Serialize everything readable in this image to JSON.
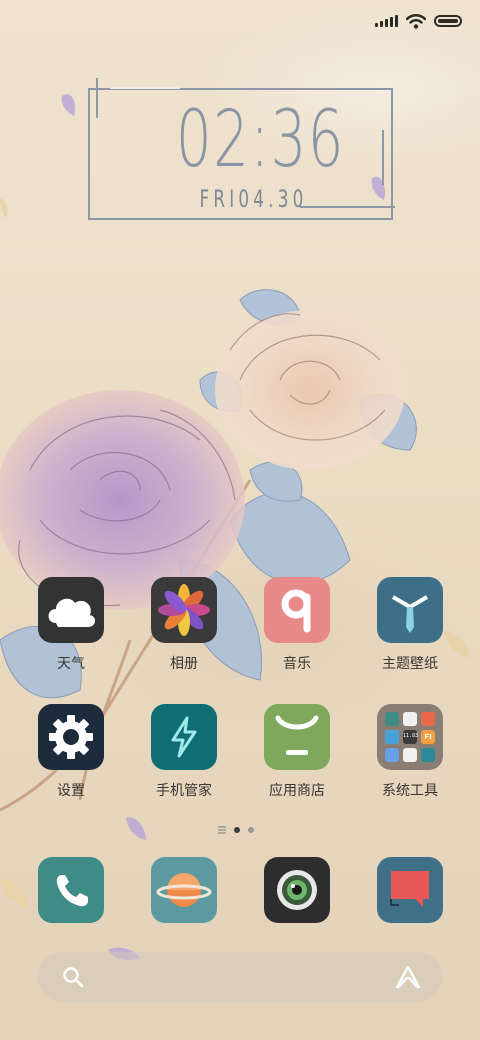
{
  "status_bar": {
    "signal": "signal-icon",
    "wifi": "wifi-icon",
    "battery": "battery-icon"
  },
  "clock": {
    "time": "02:36",
    "date": "FRI04.30"
  },
  "apps": [
    {
      "label": "天气",
      "icon": "weather-cloud-icon"
    },
    {
      "label": "相册",
      "icon": "gallery-flower-icon"
    },
    {
      "label": "音乐",
      "icon": "music-q-icon"
    },
    {
      "label": "主题壁纸",
      "icon": "themes-tie-icon"
    },
    {
      "label": "设置",
      "icon": "settings-gear-icon"
    },
    {
      "label": "手机管家",
      "icon": "security-bolt-icon"
    },
    {
      "label": "应用商店",
      "icon": "app-store-bag-icon"
    },
    {
      "label": "系统工具",
      "icon": "system-tools-folder-icon"
    }
  ],
  "folder_mini_labels": [
    "11.83",
    "FI"
  ],
  "pager": {
    "pages": 2,
    "active": 1
  },
  "dock": [
    {
      "icon": "phone-icon"
    },
    {
      "icon": "browser-planet-icon"
    },
    {
      "icon": "camera-icon"
    },
    {
      "icon": "messages-icon"
    }
  ],
  "search": {
    "icon": "search-icon",
    "assistant_icon": "assistant-a-icon"
  },
  "colors": {
    "weather": "#333333",
    "gallery": "#3a3a3a",
    "music": "#e88a8a",
    "themes": "#3d7088",
    "settings": "#1d2b3a",
    "security": "#0f6e74",
    "store": "#7fa85c",
    "dock_phone": "#3f8c86",
    "dock_browser": "#5a9aa0",
    "dock_camera": "#2d2d2d",
    "dock_messages": "#3f7088"
  }
}
